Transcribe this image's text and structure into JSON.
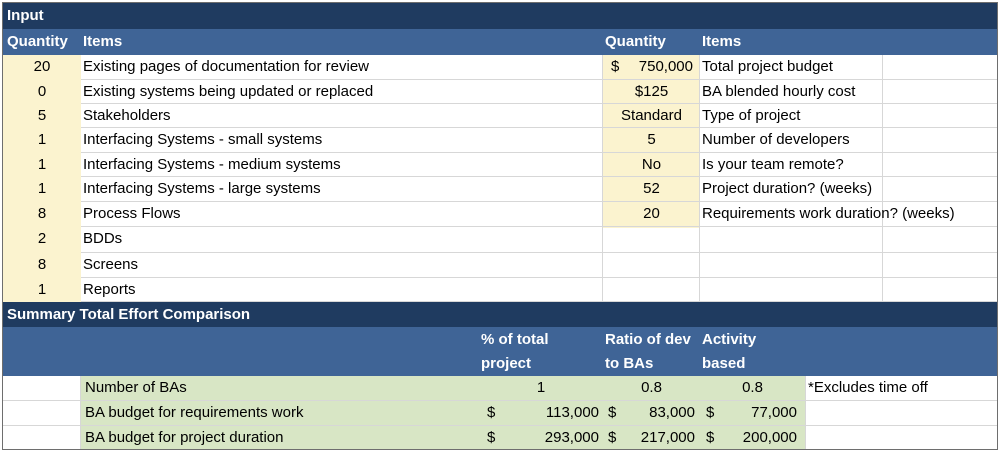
{
  "input": {
    "title": "Input",
    "left_headers": {
      "quantity": "Quantity",
      "items": "Items"
    },
    "right_headers": {
      "quantity": "Quantity",
      "items": "Items"
    },
    "left_rows": [
      {
        "qty": "20",
        "item": "Existing pages of documentation for review"
      },
      {
        "qty": "0",
        "item": "Existing systems being updated or replaced"
      },
      {
        "qty": "5",
        "item": "Stakeholders"
      },
      {
        "qty": "1",
        "item": "Interfacing Systems - small systems"
      },
      {
        "qty": "1",
        "item": "Interfacing Systems - medium systems"
      },
      {
        "qty": "1",
        "item": "Interfacing Systems - large systems"
      },
      {
        "qty": "8",
        "item": "Process Flows"
      },
      {
        "qty": "2",
        "item": "BDDs"
      },
      {
        "qty": "8",
        "item": "Screens"
      },
      {
        "qty": "1",
        "item": "Reports"
      }
    ],
    "right_rows": [
      {
        "cur": "$",
        "qty": "750,000",
        "item": "Total project budget"
      },
      {
        "cur": "",
        "qty": "$125",
        "item": "BA blended hourly cost"
      },
      {
        "cur": "",
        "qty": "Standard",
        "item": "Type of project"
      },
      {
        "cur": "",
        "qty": "5",
        "item": "Number of developers"
      },
      {
        "cur": "",
        "qty": "No",
        "item": "Is your team remote?"
      },
      {
        "cur": "",
        "qty": "52",
        "item": "Project duration? (weeks)"
      },
      {
        "cur": "",
        "qty": "20",
        "item": "Requirements work duration? (weeks)"
      }
    ]
  },
  "summary": {
    "title": "Summary Total Effort Comparison",
    "headers": {
      "pct_line1": "% of total",
      "pct_line2": "project",
      "ratio_line1": "Ratio of dev",
      "ratio_line2": "to BAs",
      "activity_line1": "Activity",
      "activity_line2": "based"
    },
    "rows": [
      {
        "label": "Number of BAs",
        "pct_cur": "",
        "pct": "1",
        "ratio_cur": "",
        "ratio": "0.8",
        "act_cur": "",
        "act": "0.8",
        "note": "*Excludes time off"
      },
      {
        "label": "BA budget for requirements work",
        "pct_cur": "$",
        "pct": "113,000",
        "ratio_cur": "$",
        "ratio": "83,000",
        "act_cur": "$",
        "act": "77,000",
        "note": ""
      },
      {
        "label": "BA budget for project duration",
        "pct_cur": "$",
        "pct": "293,000",
        "ratio_cur": "$",
        "ratio": "217,000",
        "act_cur": "$",
        "act": "200,000",
        "note": ""
      }
    ]
  }
}
